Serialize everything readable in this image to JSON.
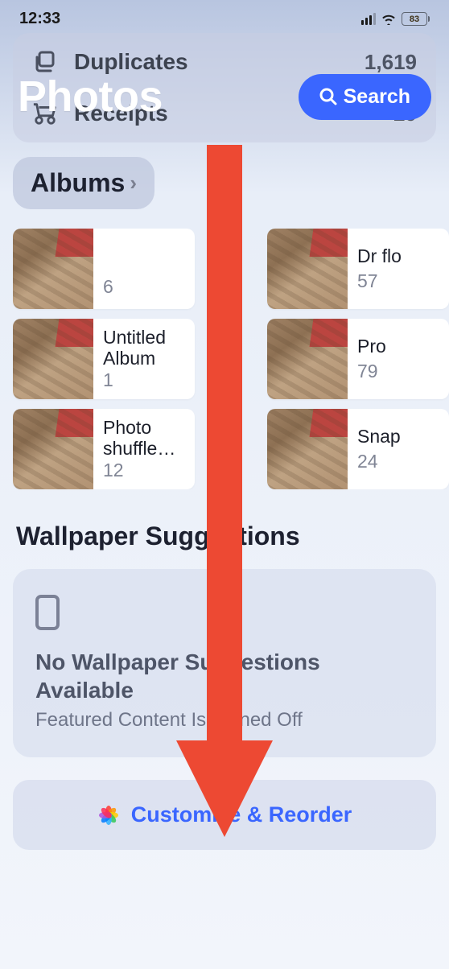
{
  "status_bar": {
    "time": "12:33",
    "battery_pct": "83"
  },
  "header": {
    "app_title": "Photos",
    "search_label": "Search",
    "rows": [
      {
        "icon": "duplicates",
        "label": "Duplicates",
        "count": "1,619"
      },
      {
        "icon": "receipts",
        "label": "Receipts",
        "count": "29"
      }
    ]
  },
  "albums": {
    "header": "Albums",
    "items": [
      {
        "title": "",
        "count": "6"
      },
      {
        "title": "Dr flo",
        "count": "57"
      },
      {
        "title": "Untitled Album",
        "count": "1"
      },
      {
        "title": "Pro",
        "count": "79"
      },
      {
        "title": "Photo shuffle fo…",
        "count": "12"
      },
      {
        "title": "Snap",
        "count": "24"
      }
    ]
  },
  "wallpaper": {
    "heading": "Wallpaper Suggestions",
    "title": "No Wallpaper Suggestions Available",
    "subtitle": "Featured Content Is Turned Off"
  },
  "customize": {
    "label": "Customize & Reorder"
  },
  "annotation": {
    "arrow_color": "#ed4933"
  }
}
